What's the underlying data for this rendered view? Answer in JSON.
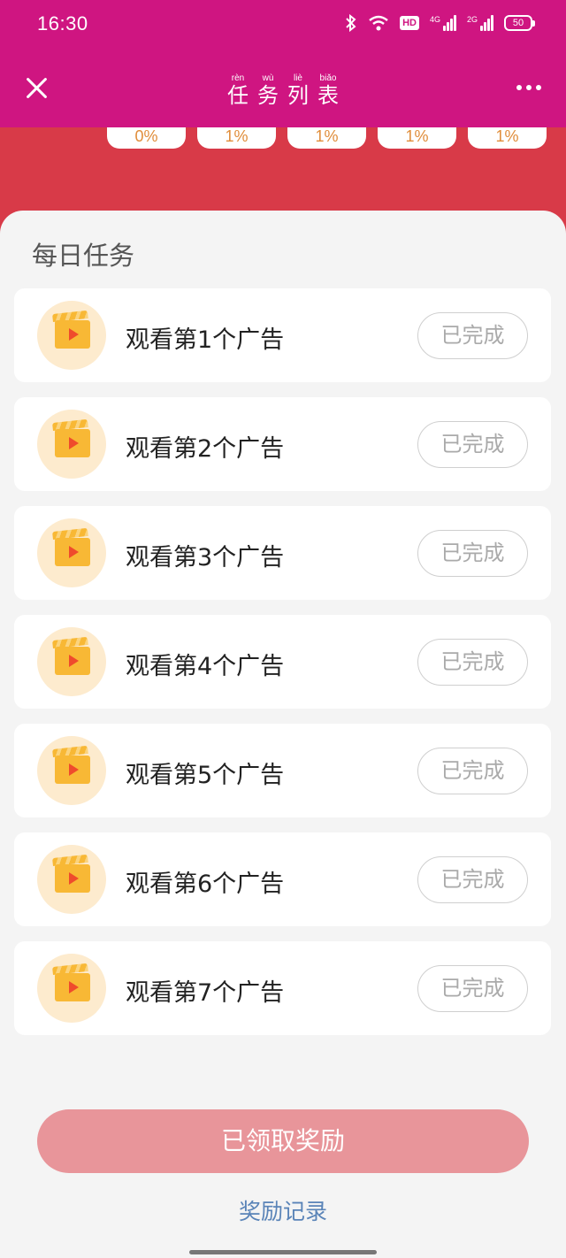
{
  "status_bar": {
    "time": "16:30",
    "hd_label": "HD",
    "net1_label": "4G",
    "net2_label": "2G",
    "battery": "50",
    "icons": [
      "bluetooth-icon",
      "wifi-icon",
      "hd-icon",
      "signal-icon",
      "signal-icon",
      "battery-icon"
    ]
  },
  "header": {
    "title_chars": [
      {
        "pinyin": "rèn",
        "hanzi": "任"
      },
      {
        "pinyin": "wù",
        "hanzi": "务"
      },
      {
        "pinyin": "liè",
        "hanzi": "列"
      },
      {
        "pinyin": "biǎo",
        "hanzi": "表"
      }
    ],
    "close_icon": "close-icon",
    "more_icon": "more-icon"
  },
  "progress_percents": [
    "0%",
    "1%",
    "1%",
    "1%",
    "1%"
  ],
  "daily_tasks": {
    "title": "每日任务",
    "items": [
      {
        "label": "观看第1个广告",
        "status": "已完成"
      },
      {
        "label": "观看第2个广告",
        "status": "已完成"
      },
      {
        "label": "观看第3个广告",
        "status": "已完成"
      },
      {
        "label": "观看第4个广告",
        "status": "已完成"
      },
      {
        "label": "观看第5个广告",
        "status": "已完成"
      },
      {
        "label": "观看第6个广告",
        "status": "已完成"
      },
      {
        "label": "观看第7个广告",
        "status": "已完成"
      }
    ]
  },
  "footer": {
    "claim_button": "已领取奖励",
    "record_link": "奖励记录"
  },
  "colors": {
    "header_bg": "#cf1581",
    "red_band": "#d83a48",
    "claim_button_bg": "#e8959a",
    "link": "#5a84b8",
    "percent_text": "#e08d3a"
  }
}
